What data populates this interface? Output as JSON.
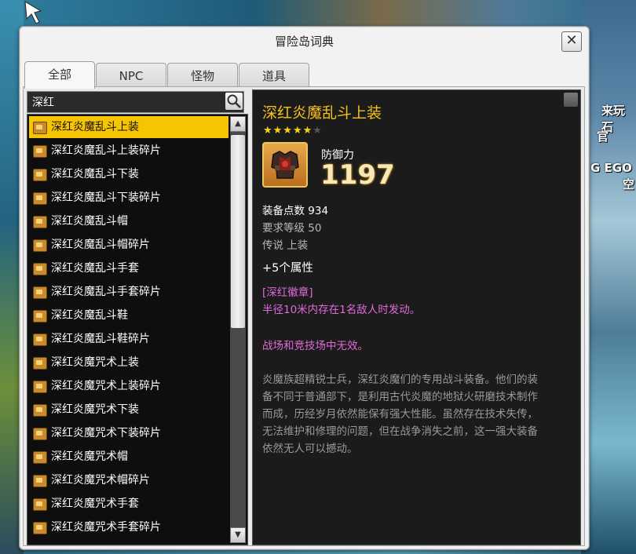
{
  "window": {
    "title": "冒险岛词典",
    "close_label": "✕"
  },
  "tabs": [
    "全部",
    "NPC",
    "怪物",
    "道具"
  ],
  "search": {
    "value": "深红"
  },
  "list": {
    "selected_index": 0,
    "items": [
      "深红炎魔乱斗上装",
      "深红炎魔乱斗上装碎片",
      "深红炎魔乱斗下装",
      "深红炎魔乱斗下装碎片",
      "深红炎魔乱斗帽",
      "深红炎魔乱斗帽碎片",
      "深红炎魔乱斗手套",
      "深红炎魔乱斗手套碎片",
      "深红炎魔乱斗鞋",
      "深红炎魔乱斗鞋碎片",
      "深红炎魔咒术上装",
      "深红炎魔咒术上装碎片",
      "深红炎魔咒术下装",
      "深红炎魔咒术下装碎片",
      "深红炎魔咒术帽",
      "深红炎魔咒术帽碎片",
      "深红炎魔咒术手套",
      "深红炎魔咒术手套碎片"
    ]
  },
  "detail": {
    "name": "深红炎魔乱斗上装",
    "stars_filled": 5,
    "stars_total": 6,
    "stat_label": "防御力",
    "stat_value": "1197",
    "equip_points": "装备点数 934",
    "req_level": "要求等级 50",
    "rarity": "传说 上装",
    "attributes": "+5个属性",
    "set_name": "[深红徽章]",
    "set_effect": "半径10米内存在1名敌人时发动。",
    "set_note": "战场和竞技场中无效。",
    "description": "炎魔族超精锐士兵，深红炎魔们的专用战斗装备。他们的装备不同于普通部下，是利用古代炎魔的地狱火研磨技术制作而成，历经岁月依然能保有强大性能。虽然存在技术失传，无法维护和修理的问题，但在战争消失之前，这一强大装备依然无人可以撼动。"
  },
  "background": {
    "text_1": "来玩石",
    "text_2": "G EGO",
    "text_3": "空",
    "text_4": "官"
  },
  "colors": {
    "selected": "#f6c400",
    "title_gold": "#f7c21a",
    "set_pink": "#e06ad8"
  }
}
